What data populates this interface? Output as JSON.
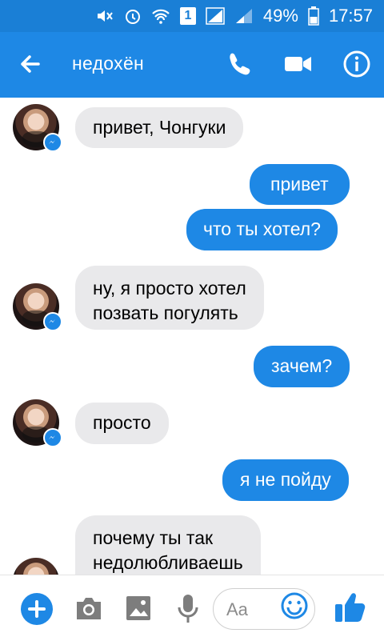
{
  "status_bar": {
    "battery": "49%",
    "time": "17:57",
    "sim": "1"
  },
  "header": {
    "title": "недохён"
  },
  "messages": [
    {
      "dir": "in",
      "text": "привет, Чонгуки"
    },
    {
      "dir": "out",
      "text": "привет"
    },
    {
      "dir": "out",
      "text": "что ты хотел?"
    },
    {
      "dir": "in",
      "text_lines": [
        "ну, я просто хотел",
        "позвать погулять"
      ]
    },
    {
      "dir": "out",
      "text": "зачем?"
    },
    {
      "dir": "in",
      "text": "просто"
    },
    {
      "dir": "out",
      "text": "я не пойду"
    },
    {
      "dir": "in",
      "text_lines": [
        "почему ты так",
        "недолюбливаешь"
      ]
    }
  ],
  "composer": {
    "placeholder": "Aa"
  },
  "colors": {
    "accent": "#1e88e5",
    "incoming_bubble": "#e9e9eb"
  }
}
